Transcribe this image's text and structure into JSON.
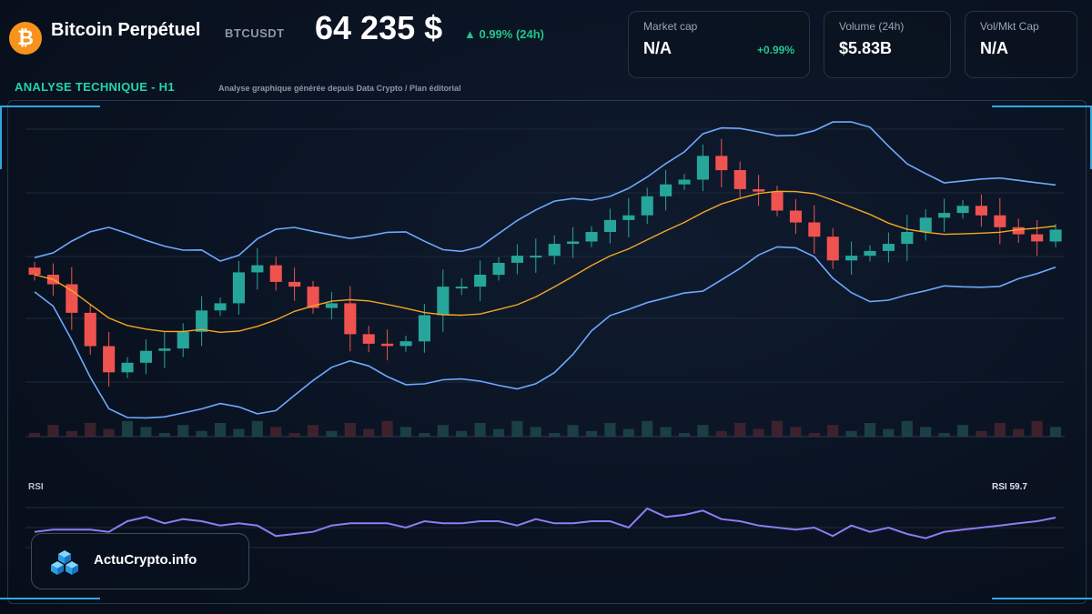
{
  "header": {
    "pair_name": "Bitcoin Perpétuel",
    "ticker": "BTCUSDT",
    "price": "64 235 $",
    "change": "▲ 0.99% (24h)"
  },
  "cards": [
    {
      "label": "Market cap",
      "value": "N/A",
      "extra": "+0.99%"
    },
    {
      "label": "Volume (24h)",
      "value": "$5.83B",
      "extra": ""
    },
    {
      "label": "Vol/Mkt Cap",
      "value": "N/A",
      "extra": ""
    }
  ],
  "analysis": {
    "title": "ANALYSE TECHNIQUE - H1",
    "subtitle": "Analyse graphique générée depuis Data Crypto / Plan éditorial"
  },
  "rsi": {
    "label": "RSI",
    "value_label": "RSI 59.7"
  },
  "brand": {
    "name": "ActuCrypto.info"
  },
  "colors": {
    "up": "#26a69a",
    "down": "#ef5350",
    "bollinger": "#6fa8ff",
    "ma": "#f5a623",
    "rsi_line": "#8f7cf2",
    "accent": "#22d3b0",
    "positive": "#22c58b"
  },
  "chart_data": [
    {
      "type": "candlestick",
      "title": "ANALYSE TECHNIQUE - H1",
      "overlays": [
        "bollinger-bands",
        "moving-average",
        "volume"
      ],
      "grid": true,
      "close": [
        62100,
        61900,
        61300,
        60600,
        60050,
        60250,
        60500,
        60550,
        60900,
        61350,
        61500,
        62150,
        62300,
        61950,
        61850,
        61400,
        61500,
        60850,
        60650,
        60600,
        60700,
        61250,
        61850,
        61850,
        62100,
        62350,
        62500,
        62500,
        62750,
        62800,
        63000,
        63250,
        63350,
        63750,
        64000,
        64100,
        64600,
        64300,
        63900,
        63850,
        63450,
        63200,
        62900,
        62400,
        62500,
        62600,
        62750,
        63000,
        63300,
        63400,
        63550,
        63350,
        63100,
        62950,
        62800,
        63050
      ]
    },
    {
      "type": "line",
      "name": "RSI",
      "last_value": 59.7,
      "values": [
        53,
        54,
        54,
        54,
        53,
        58,
        60,
        57,
        59,
        58,
        56,
        57,
        56,
        51,
        52,
        53,
        56,
        57,
        57,
        57,
        55,
        58,
        57,
        57,
        58,
        58,
        56,
        59,
        57,
        57,
        58,
        58,
        55,
        64,
        60,
        61,
        63,
        59,
        58,
        56,
        55,
        54,
        55,
        51,
        56,
        53,
        55,
        52,
        50,
        53,
        54,
        55,
        56,
        57,
        58,
        59.7
      ]
    }
  ]
}
